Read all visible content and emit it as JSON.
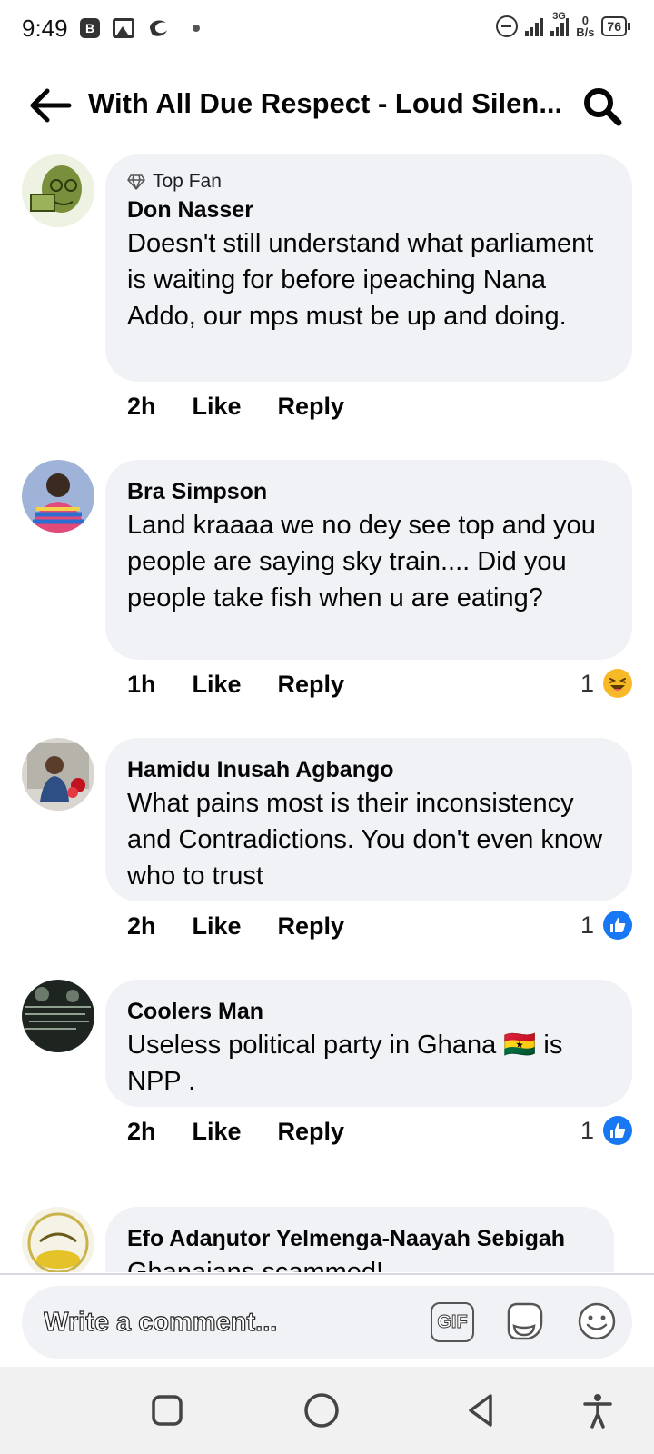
{
  "status_bar": {
    "time": "9:49",
    "badge": "B",
    "network": "3G",
    "net_speed_value": "0",
    "net_speed_unit": "B/s",
    "battery": "76"
  },
  "header": {
    "title": "With All Due Respect - Loud Silen..."
  },
  "comments": [
    {
      "badge": "Top Fan",
      "author": "Don Nasser",
      "text": "Doesn't still understand what parliament is waiting for before ipeaching Nana Addo, our mps must be up and doing.",
      "time": "2h",
      "like": "Like",
      "reply": "Reply"
    },
    {
      "author": "Bra Simpson",
      "text": "Land kraaaa we no dey see top and you people are saying sky train.... Did you people take fish when u are eating?",
      "time": "1h",
      "like": "Like",
      "reply": "Reply",
      "reaction_count": "1",
      "reaction_type": "haha-icon"
    },
    {
      "author": "Hamidu Inusah Agbango",
      "text": "What pains most is their inconsistency and Contradictions. You don't even know who to trust",
      "time": "2h",
      "like": "Like",
      "reply": "Reply",
      "reaction_count": "1",
      "reaction_type": "like-icon"
    },
    {
      "author": "Coolers Man",
      "text": "Useless political party in Ghana 🇬🇭 is NPP .",
      "time": "2h",
      "like": "Like",
      "reply": "Reply",
      "reaction_count": "1",
      "reaction_type": "like-icon"
    },
    {
      "author": "Efo Adaŋutor Yelmenga-Naayah Sebigah",
      "text": "Ghanaians scammed!"
    }
  ],
  "composer": {
    "placeholder": "Write a comment...",
    "gif_label": "GIF"
  },
  "colors": {
    "bubble": "#f0f2f5",
    "like_blue": "#1877f2",
    "haha_yellow": "#f7b928"
  }
}
